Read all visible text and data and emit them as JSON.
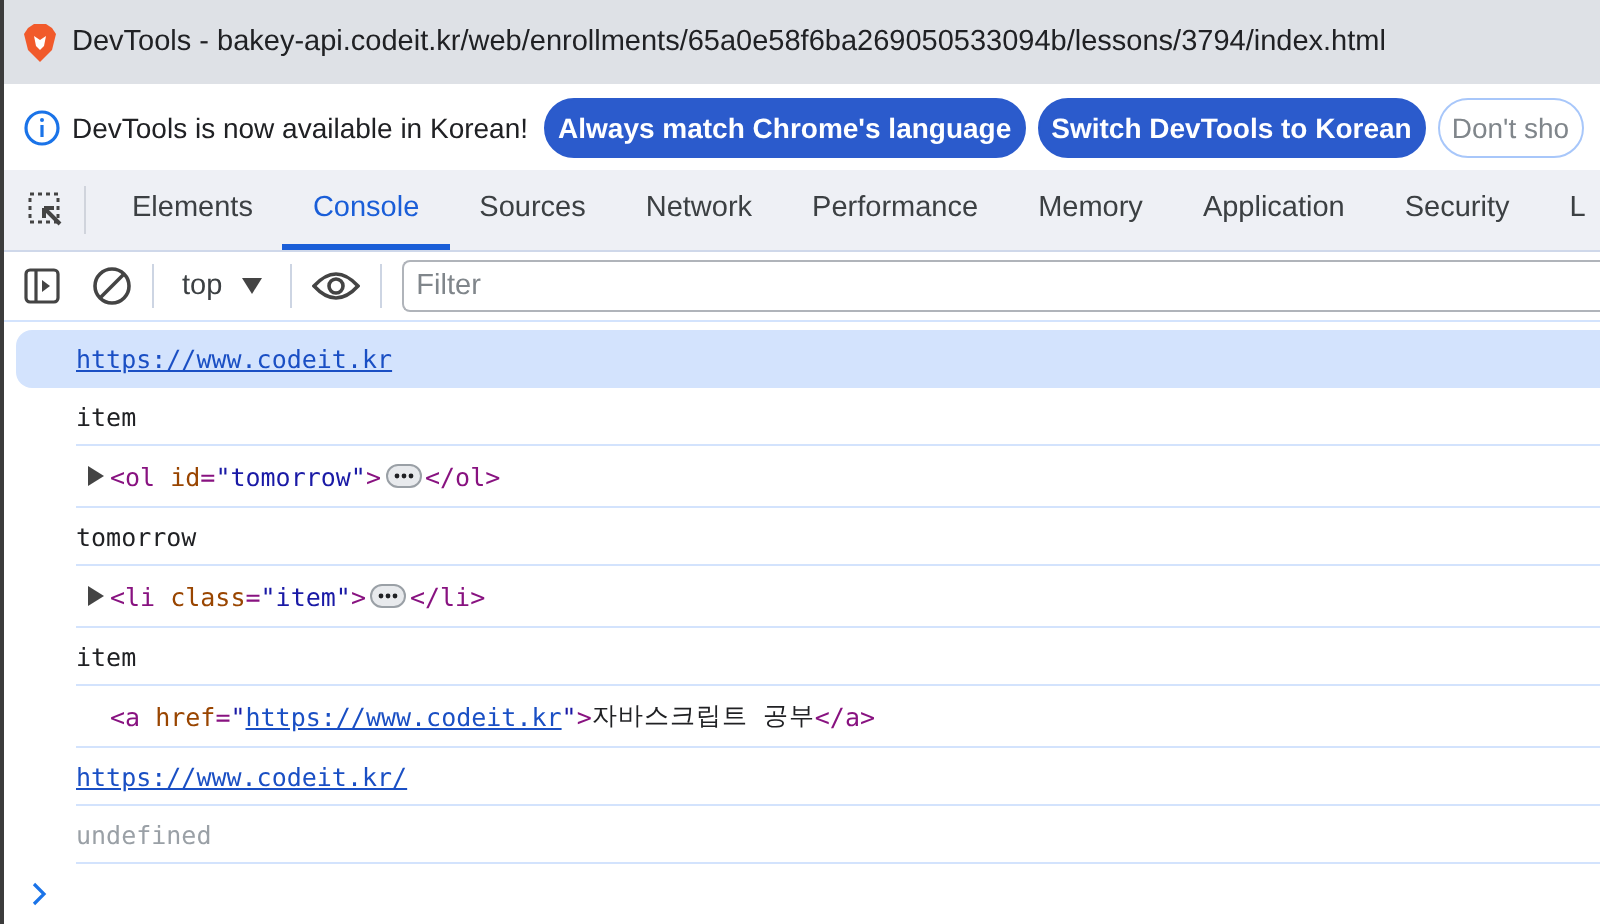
{
  "window": {
    "title": "DevTools - bakey-api.codeit.kr/web/enrollments/65a0e58f6ba269050533094b/lessons/3794/index.html"
  },
  "infobar": {
    "message": "DevTools is now available in Korean!",
    "buttons": [
      {
        "label": "Always match Chrome's language",
        "kind": "primary"
      },
      {
        "label": "Switch DevTools to Korean",
        "kind": "primary"
      },
      {
        "label": "Don't sho",
        "kind": "outline"
      }
    ]
  },
  "tabs": [
    {
      "label": "Elements",
      "selected": false
    },
    {
      "label": "Console",
      "selected": true
    },
    {
      "label": "Sources",
      "selected": false
    },
    {
      "label": "Network",
      "selected": false
    },
    {
      "label": "Performance",
      "selected": false
    },
    {
      "label": "Memory",
      "selected": false
    },
    {
      "label": "Application",
      "selected": false
    },
    {
      "label": "Security",
      "selected": false
    },
    {
      "label": "L",
      "selected": false
    }
  ],
  "toolbar": {
    "context": "top",
    "filter_placeholder": "Filter"
  },
  "console": [
    {
      "kind": "link",
      "selected": true,
      "tokens": [
        {
          "kind": "link",
          "text": "https://www.codeit.kr"
        }
      ]
    },
    {
      "kind": "text",
      "selected": false,
      "tokens": [
        {
          "kind": "plain",
          "text": "item"
        }
      ]
    },
    {
      "kind": "element",
      "selected": false,
      "expanded": false,
      "tokens": [
        {
          "kind": "tag",
          "text": "<ol "
        },
        {
          "kind": "attr",
          "text": "id"
        },
        {
          "kind": "tag",
          "text": "="
        },
        {
          "kind": "value",
          "text": "\"tomorrow\""
        },
        {
          "kind": "tag",
          "text": ">"
        },
        {
          "kind": "ellipsis"
        },
        {
          "kind": "tag",
          "text": "</ol>"
        }
      ]
    },
    {
      "kind": "text",
      "selected": false,
      "tokens": [
        {
          "kind": "plain",
          "text": "tomorrow"
        }
      ]
    },
    {
      "kind": "element",
      "selected": false,
      "expanded": false,
      "tokens": [
        {
          "kind": "tag",
          "text": "<li "
        },
        {
          "kind": "attr",
          "text": "class"
        },
        {
          "kind": "tag",
          "text": "="
        },
        {
          "kind": "value",
          "text": "\"item\""
        },
        {
          "kind": "tag",
          "text": ">"
        },
        {
          "kind": "ellipsis"
        },
        {
          "kind": "tag",
          "text": "</li>"
        }
      ]
    },
    {
      "kind": "text",
      "selected": false,
      "tokens": [
        {
          "kind": "plain",
          "text": "item"
        }
      ]
    },
    {
      "kind": "leaf",
      "selected": false,
      "tokens": [
        {
          "kind": "tag",
          "text": "<a "
        },
        {
          "kind": "attr",
          "text": "href"
        },
        {
          "kind": "tag",
          "text": "="
        },
        {
          "kind": "value",
          "text": "\""
        },
        {
          "kind": "link",
          "text": "https://www.codeit.kr"
        },
        {
          "kind": "value",
          "text": "\""
        },
        {
          "kind": "tag",
          "text": ">"
        },
        {
          "kind": "plain",
          "text": "자바스크립트 공부"
        },
        {
          "kind": "tag",
          "text": "</a>"
        }
      ]
    },
    {
      "kind": "link",
      "selected": false,
      "tokens": [
        {
          "kind": "link",
          "text": "https://www.codeit.kr/"
        }
      ]
    },
    {
      "kind": "result",
      "selected": false,
      "tokens": [
        {
          "kind": "plain",
          "text": "undefined"
        }
      ]
    }
  ]
}
